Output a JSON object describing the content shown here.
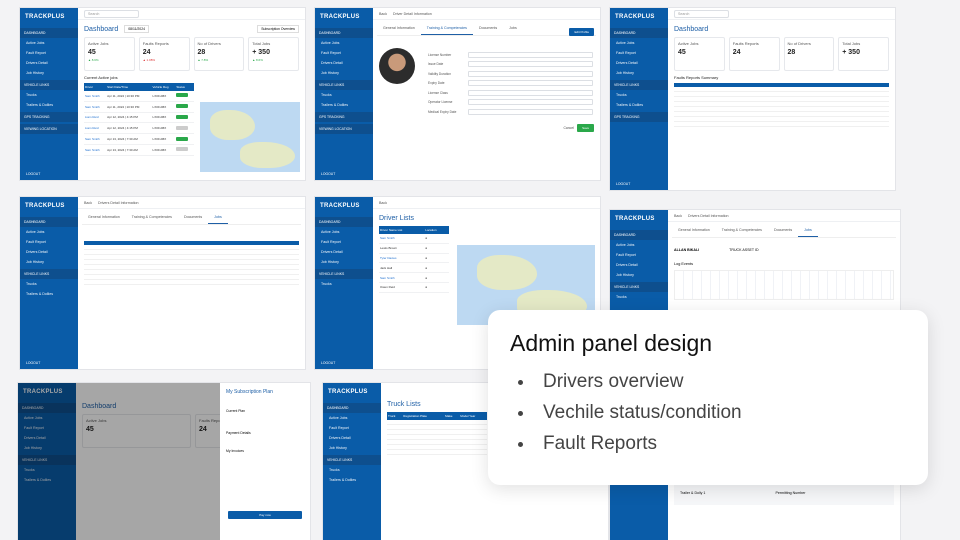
{
  "overlay": {
    "title": "Admin panel design",
    "bullets": [
      "Drivers overview",
      "Vechile status/condition",
      "Fault Reports"
    ]
  },
  "brand": "TRACKPLUS",
  "nav": [
    "DASHBOARD",
    "Active Jobs",
    "Fault Report",
    "Drivers Detail",
    "Job History",
    "VEHICLE LINKS",
    "Trucks",
    "Trailers & Dollies",
    "GPS TRACKING",
    "VIEWING LOCATION"
  ],
  "logout": "LOGOUT",
  "search": "Search",
  "dashboard": {
    "title": "Dashboard",
    "subscription": "Subscription Overview",
    "date": "08/11/2024",
    "cards": [
      {
        "label": "Active Jobs",
        "value": "45",
        "delta": "▲ 8.6%"
      },
      {
        "label": "Faults Reports",
        "value": "24",
        "delta": "▲ 1.08%"
      },
      {
        "label": "No of Drivers",
        "value": "28",
        "delta": "▲ 7.8%"
      },
      {
        "label": "Total Jobs",
        "value": "+ 350",
        "delta": "▲ 8.6%"
      }
    ],
    "current_jobs": "Current Active jobs",
    "job_cols": [
      "Driver",
      "Start Date/Time",
      "Vehicle Reg",
      "Status"
    ],
    "job_rows": [
      [
        "Sam Smith",
        "Apr 11, 2024 | 10:30 PM",
        "LX09 ABX",
        "Active"
      ],
      [
        "Sam Smith",
        "Apr 11, 2024 | 10:30 PM",
        "LX09 ABX",
        "Active"
      ],
      [
        "Liam Reid",
        "Apr 12, 2024 | 4:15 PM",
        "LX09 ABX",
        "Active"
      ],
      [
        "Liam Reid",
        "Apr 12, 2024 | 4:15 PM",
        "LX09 ABX",
        "Active"
      ],
      [
        "Sam Smith",
        "Apr 13, 2024 | 7:30 AM",
        "LX09 ABX",
        "Active"
      ],
      [
        "Sam Smith",
        "Apr 13, 2024 | 7:30 AM",
        "LX09 ABX",
        "Active"
      ]
    ]
  },
  "driver_detail": {
    "back": "Back",
    "title": "Driver Detail Information",
    "tabs": [
      "General Information",
      "Training & Competencies",
      "Documents",
      "Jobs"
    ],
    "edit": "Edit Profile",
    "fields": [
      "License Number",
      "Issue Date",
      "Validity Duration",
      "Expiry Date",
      "License Class",
      "Operator License",
      "Medical Expiry Date"
    ],
    "cancel": "Cancel",
    "save": "Save"
  },
  "faults": {
    "title": "Faults Reports Summary",
    "rows": 7
  },
  "drivers_list": {
    "title": "Driver Lists",
    "cols": [
      "Driver Name List",
      "Location"
    ],
    "names": [
      "Sam Smith",
      "Lewis Brown",
      "Tyler Davies",
      "Jack Hall",
      "Sam Smith",
      "Owen Reid"
    ]
  },
  "truck": {
    "title": "Truck Lists",
    "cols": [
      "Truck",
      "Registration Plate",
      "Make",
      "Model Year"
    ]
  },
  "subscription": {
    "title": "My Subscription Plan",
    "current": "Current Plan",
    "payment": "Payment Details",
    "invoices": "My Invoices",
    "button": "Pay now"
  },
  "jobs_tab": {
    "title": "Drivers Detail Information",
    "status": "Completed"
  },
  "log": {
    "title": "Log Events",
    "driver": "ALLAN BIKALI",
    "asset": "TRUCK ASSET ID",
    "trailer": "Trailer & Dolly 1",
    "permit": "Permitting Number"
  }
}
